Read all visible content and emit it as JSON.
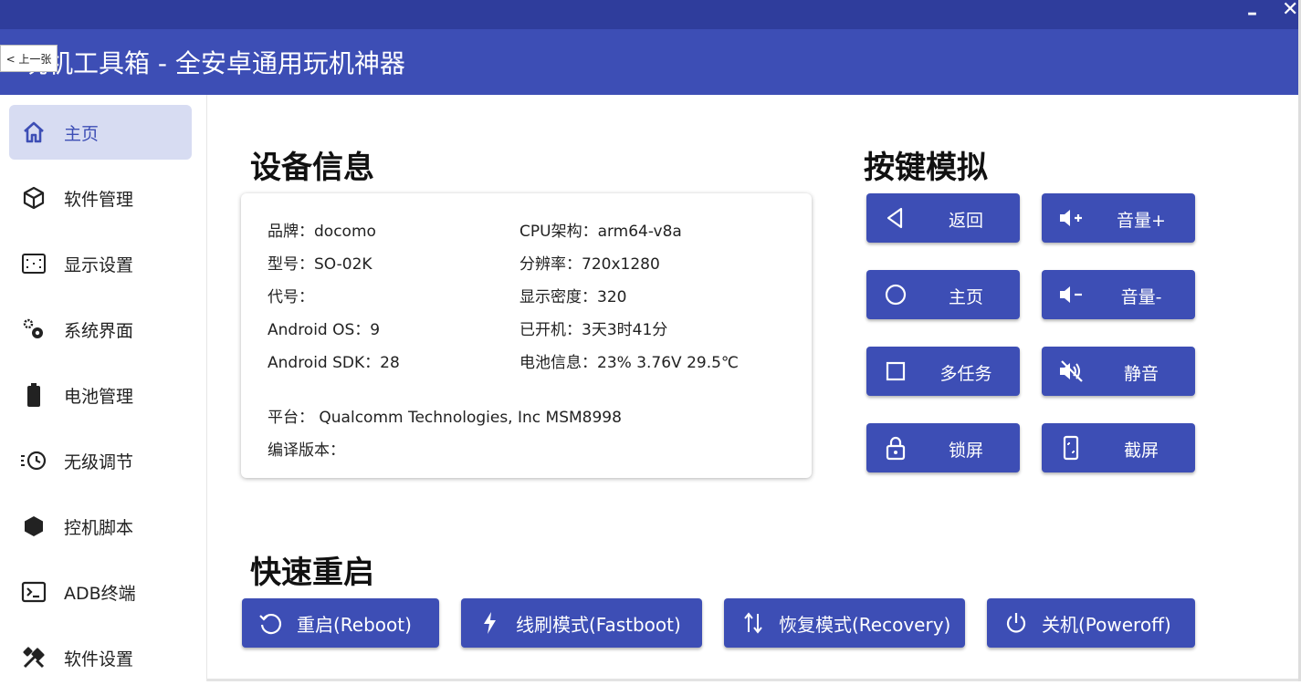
{
  "window": {
    "title": "玩机工具箱 - 全安卓通用玩机神器",
    "minimize_glyph": "–",
    "close_glyph": "✕",
    "prev_button_label": "< 上一张"
  },
  "sidebar": {
    "items": [
      {
        "label": "主页",
        "icon": "home-icon"
      },
      {
        "label": "软件管理",
        "icon": "package-icon"
      },
      {
        "label": "显示设置",
        "icon": "screen-icon"
      },
      {
        "label": "系统界面",
        "icon": "gears-icon"
      },
      {
        "label": "电池管理",
        "icon": "battery-icon"
      },
      {
        "label": "无级调节",
        "icon": "clock-icon"
      },
      {
        "label": "控机脚本",
        "icon": "hexagon-icon"
      },
      {
        "label": "ADB终端",
        "icon": "terminal-icon"
      },
      {
        "label": "软件设置",
        "icon": "tools-icon"
      }
    ],
    "active_index": 0
  },
  "device_info": {
    "title": "设备信息",
    "brand": "品牌：docomo",
    "model": "型号：SO-02K",
    "codename": "代号：",
    "android_os": "Android OS：9",
    "android_sdk": "Android SDK：28",
    "cpu_arch": "CPU架构：arm64-v8a",
    "resolution": "分辨率：720x1280",
    "density": "显示密度：320",
    "uptime": "已开机：3天3时41分",
    "battery": "电池信息：23%  3.76V  29.5℃",
    "platform": "平台： Qualcomm Technologies, Inc MSM8998",
    "build": "编译版本："
  },
  "key_sim": {
    "title": "按键模拟",
    "buttons": [
      {
        "label": "返回",
        "icon": "back-triangle-icon"
      },
      {
        "label": "音量+",
        "icon": "volume-up-icon"
      },
      {
        "label": "主页",
        "icon": "home-circle-icon"
      },
      {
        "label": "音量-",
        "icon": "volume-down-icon"
      },
      {
        "label": "多任务",
        "icon": "square-icon"
      },
      {
        "label": "静音",
        "icon": "mute-icon"
      },
      {
        "label": "锁屏",
        "icon": "lock-icon"
      },
      {
        "label": "截屏",
        "icon": "screenshot-icon"
      }
    ]
  },
  "quick_reboot": {
    "title": "快速重启",
    "buttons": [
      {
        "label": "重启(Reboot)",
        "icon": "refresh-icon"
      },
      {
        "label": "线刷模式(Fastboot)",
        "icon": "lightning-icon"
      },
      {
        "label": "恢复模式(Recovery)",
        "icon": "up-down-arrows-icon"
      },
      {
        "label": "关机(Poweroff)",
        "icon": "power-icon"
      }
    ]
  },
  "colors": {
    "primary": "#3d4eb5",
    "title_strip": "#2f3d9c",
    "active_nav": "#d7dcf2"
  }
}
